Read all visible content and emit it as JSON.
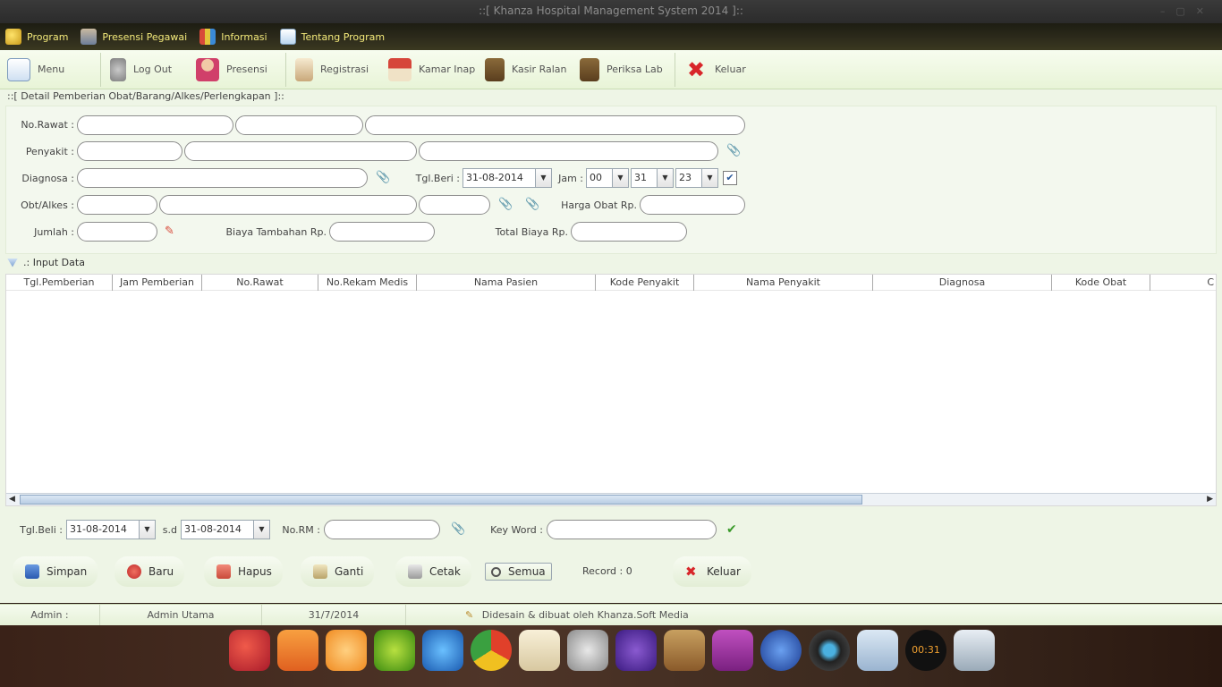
{
  "window": {
    "title": "::[ Khanza Hospital Management System 2014 ]::"
  },
  "menubar": [
    {
      "label": "Program",
      "icon": "key-icon"
    },
    {
      "label": "Presensi Pegawai",
      "icon": "employee-icon"
    },
    {
      "label": "Informasi",
      "icon": "chart-icon"
    },
    {
      "label": "Tentang Program",
      "icon": "clipboard-icon"
    }
  ],
  "toolbar": {
    "menu": "Menu",
    "logout": "Log Out",
    "presensi": "Presensi",
    "registrasi": "Registrasi",
    "kamar_inap": "Kamar Inap",
    "kasir_ralan": "Kasir Ralan",
    "periksa_lab": "Periksa Lab",
    "keluar": "Keluar"
  },
  "panel": {
    "title": "::[ Detail Pemberian Obat/Barang/Alkes/Perlengkapan ]::"
  },
  "form": {
    "no_rawat_label": "No.Rawat :",
    "penyakit_label": "Penyakit :",
    "diagnosa_label": "Diagnosa :",
    "obt_alkes_label": "Obt/Alkes :",
    "jumlah_label": "Jumlah :",
    "tgl_beri_label": "Tgl.Beri :",
    "tgl_beri_value": "31-08-2014",
    "jam_label": "Jam :",
    "jam_hour": "00",
    "jam_minute": "31",
    "jam_second": "23",
    "harga_obat_label": "Harga Obat Rp.",
    "biaya_tambahan_label": "Biaya Tambahan Rp.",
    "total_biaya_label": "Total Biaya Rp."
  },
  "section": {
    "input_data_label": ".: Input Data"
  },
  "table": {
    "columns": [
      "Tgl.Pemberian",
      "Jam Pemberian",
      "No.Rawat",
      "No.Rekam Medis",
      "Nama Pasien",
      "Kode Penyakit",
      "Nama Penyakit",
      "Diagnosa",
      "Kode Obat",
      "C"
    ]
  },
  "filter": {
    "tgl_beli_label": "Tgl.Beli :",
    "tgl_from": "31-08-2014",
    "sd_label": "s.d",
    "tgl_to": "31-08-2014",
    "no_rm_label": "No.RM :",
    "keyword_label": "Key Word :"
  },
  "actions": {
    "simpan": "Simpan",
    "baru": "Baru",
    "hapus": "Hapus",
    "ganti": "Ganti",
    "cetak": "Cetak",
    "semua": "Semua",
    "record_label": "Record : 0",
    "keluar": "Keluar"
  },
  "status": {
    "admin_label": "Admin :",
    "admin_value": "Admin Utama",
    "date": "31/7/2014",
    "credit": "Didesain & dibuat oleh Khanza.Soft Media"
  },
  "dock_icons": [
    "rocket-icon",
    "files-icon",
    "target-icon",
    "music-icon",
    "globe-icon",
    "chrome-icon",
    "mail-icon",
    "settings-icon",
    "disk-icon",
    "contacts-icon",
    "video-icon",
    "network-icon",
    "camera-icon",
    "webcam-icon",
    "clock-icon",
    "recycle-icon"
  ],
  "dock_clock": "00:31",
  "colors": {
    "accent": "#f3e97a",
    "toolbar_bg": "#eef5e6",
    "menubar_bg": "#2e2c1c"
  }
}
